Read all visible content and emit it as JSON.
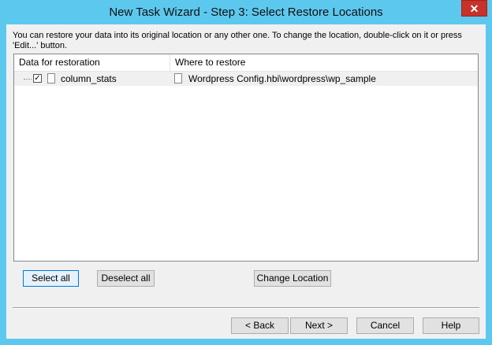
{
  "window": {
    "title": "New Task Wizard - Step 3: Select Restore Locations",
    "close_glyph": "✕"
  },
  "description": "You can restore your data into its original location or any other one. To change the location, double-click on it or press 'Edit...' button.",
  "table": {
    "columns": [
      "Data for restoration",
      "Where to restore"
    ],
    "rows": [
      {
        "name": "column_stats",
        "checked": true,
        "check_glyph": "✓",
        "destination": "Wordpress Config.hbi\\wordpress\\wp_sample"
      }
    ]
  },
  "buttons": {
    "select_all": "Select all",
    "deselect_all": "Deselect all",
    "change_location": "Change Location",
    "back": "< Back",
    "next": "Next >",
    "cancel": "Cancel",
    "help": "Help"
  },
  "icons": {
    "row_icon": "document-icon",
    "destination_icon": "document-icon"
  },
  "colors": {
    "title_bar": "#5dc8ee",
    "close_button": "#c7322b",
    "client_bg": "#f0f0f0"
  }
}
